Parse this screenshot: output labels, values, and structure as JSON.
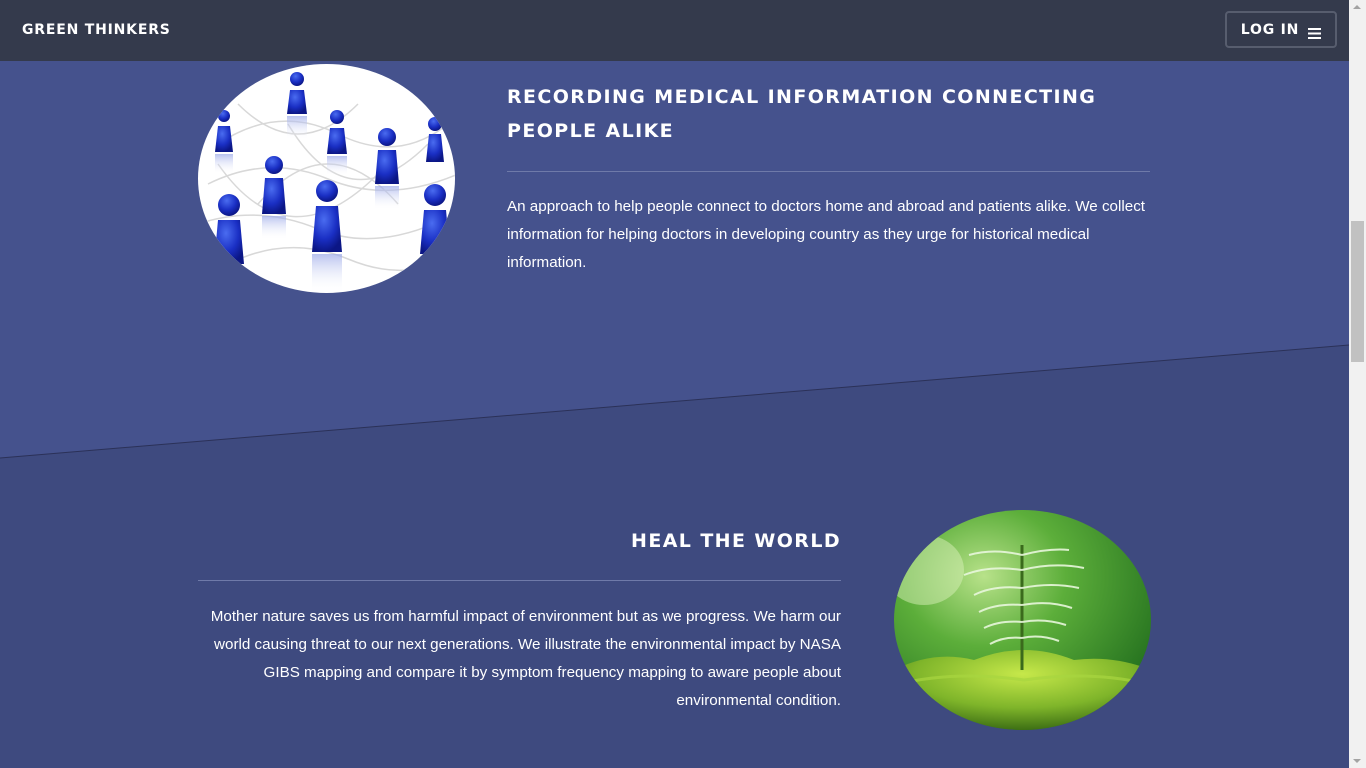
{
  "navbar": {
    "brand": "GREEN THINKERS",
    "login_label": "LOG IN",
    "menu_icon": "hamburger-menu-icon"
  },
  "sections": [
    {
      "heading": "RECORDING MEDICAL INFORMATION CONNECTING PEOPLE ALIKE",
      "text": "An approach to help people connect to doctors home and abroad and patients alike. We collect information for helping doctors in developing country as they urge for historical medical information.",
      "image": "connected-people-network-image"
    },
    {
      "heading": "HEAL THE WORLD",
      "text": "Mother nature saves us from harmful impact of environment but as we progress. We harm our world causing threat to our next generations. We illustrate the environmental impact by NASA GIBS mapping and compare it by symptom frequency mapping to aware people about environmental condition.",
      "image": "green-sprout-plant-image"
    }
  ],
  "colors": {
    "navbar": "#343a4c",
    "section_top": "#45528d",
    "section_bottom": "#3e4a7f",
    "divider": "#6f7aa9"
  }
}
